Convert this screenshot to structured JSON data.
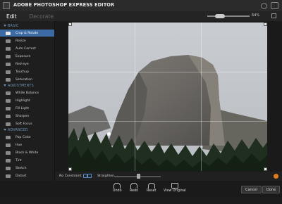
{
  "window": {
    "title": "ADOBE PHOTOSHOP EXPRESS EDITOR"
  },
  "tabs": [
    {
      "label": "Edit"
    },
    {
      "label": "Decorate"
    }
  ],
  "zoom": {
    "value": "64%",
    "level": 0.55
  },
  "sidebar": {
    "basic": {
      "label": "BASIC",
      "items": [
        {
          "label": "Crop & Rotate",
          "icon": "crop-icon",
          "selected": true
        },
        {
          "label": "Resize",
          "icon": "resize-icon"
        },
        {
          "label": "Auto Correct",
          "icon": "auto-correct-icon"
        },
        {
          "label": "Exposure",
          "icon": "exposure-icon"
        },
        {
          "label": "Red-eye",
          "icon": "red-eye-icon"
        },
        {
          "label": "Touchup",
          "icon": "touchup-icon"
        },
        {
          "label": "Saturation",
          "icon": "saturation-icon"
        }
      ]
    },
    "adjustments": {
      "label": "ADJUSTMENTS",
      "items": [
        {
          "label": "White Balance",
          "icon": "white-balance-icon"
        },
        {
          "label": "Highlight",
          "icon": "highlight-icon"
        },
        {
          "label": "Fill Light",
          "icon": "fill-light-icon"
        },
        {
          "label": "Sharpen",
          "icon": "sharpen-icon"
        },
        {
          "label": "Soft Focus",
          "icon": "soft-focus-icon"
        }
      ]
    },
    "advanced": {
      "label": "ADVANCED",
      "items": [
        {
          "label": "Pop Color",
          "icon": "pop-color-icon"
        },
        {
          "label": "Hue",
          "icon": "hue-icon"
        },
        {
          "label": "Black & White",
          "icon": "black-white-icon"
        },
        {
          "label": "Tint",
          "icon": "tint-icon"
        },
        {
          "label": "Sketch",
          "icon": "sketch-icon"
        },
        {
          "label": "Distort",
          "icon": "distort-icon"
        }
      ]
    }
  },
  "crop": {
    "constraint": "No Constraint",
    "straighten_label": "Straighten"
  },
  "actions": {
    "undo": "Undo",
    "redo": "Redo",
    "reset": "Reset",
    "view_original": "View Original",
    "cancel": "Cancel",
    "done": "Done"
  },
  "colors": {
    "accent": "#3b6aa5",
    "help": "#e27a1b"
  }
}
